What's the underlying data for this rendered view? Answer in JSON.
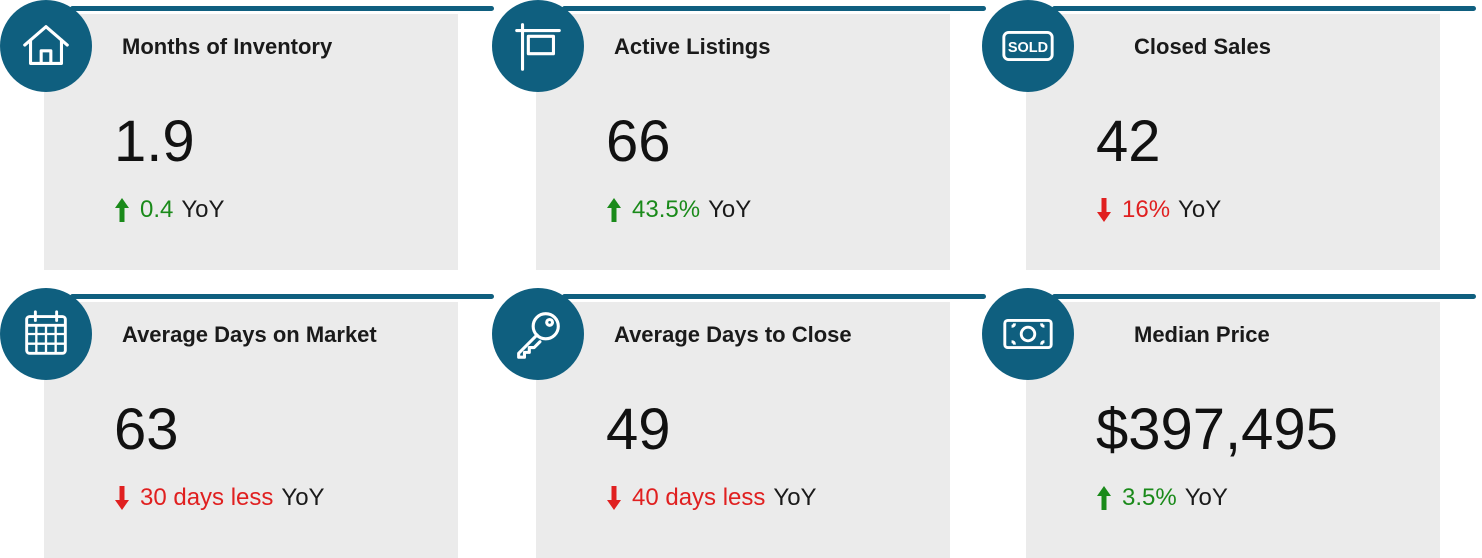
{
  "colors": {
    "accent": "#0f5f7f",
    "up": "#1a8a1a",
    "down": "#e02020",
    "panel": "#ebebeb"
  },
  "cards": [
    {
      "title": "Months of Inventory",
      "value": "1.9",
      "direction": "up",
      "delta": "0.4",
      "suffix": "YoY",
      "icon": "house-icon"
    },
    {
      "title": "Active Listings",
      "value": "66",
      "direction": "up",
      "delta": "43.5%",
      "suffix": "YoY",
      "icon": "for-sale-sign-icon"
    },
    {
      "title": "Closed Sales",
      "value": "42",
      "direction": "down",
      "delta": "16%",
      "suffix": "YoY",
      "icon": "sold-sign-icon",
      "icon_text": "SOLD"
    },
    {
      "title": "Average Days on Market",
      "value": "63",
      "direction": "down",
      "delta": "30 days less",
      "suffix": "YoY",
      "icon": "calendar-icon"
    },
    {
      "title": "Average Days to Close",
      "value": "49",
      "direction": "down",
      "delta": "40 days less",
      "suffix": "YoY",
      "icon": "key-icon"
    },
    {
      "title": "Median Price",
      "value": "$397,495",
      "direction": "up",
      "delta": "3.5%",
      "suffix": "YoY",
      "icon": "money-bill-icon"
    }
  ]
}
